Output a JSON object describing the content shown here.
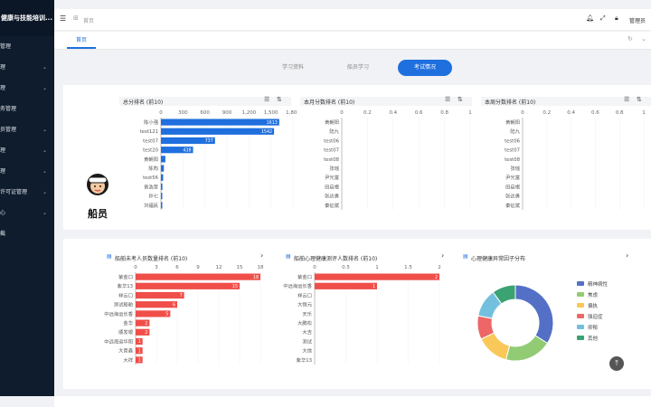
{
  "sidebar": {
    "title": "健康与技能培训...",
    "items": [
      {
        "label": "管理",
        "has_arrow": false
      },
      {
        "label": "理",
        "has_arrow": true
      },
      {
        "label": "理",
        "has_arrow": true
      },
      {
        "label": "务管理",
        "has_arrow": false
      },
      {
        "label": "员管理",
        "has_arrow": true
      },
      {
        "label": "理",
        "has_arrow": true
      },
      {
        "label": "理",
        "has_arrow": true
      },
      {
        "label": "许可证管理",
        "has_arrow": true
      },
      {
        "label": "心",
        "has_arrow": true
      },
      {
        "label": "截",
        "has_arrow": false
      }
    ]
  },
  "topbar": {
    "breadcrumb": "首页",
    "user": "管理员"
  },
  "tabs": {
    "home": "首页"
  },
  "segments": {
    "items": [
      "学习资料",
      "船员学习",
      "考试情况"
    ],
    "active": "考试情况"
  },
  "role": {
    "name": "船员"
  },
  "colors": {
    "accent": "#1f6fde",
    "bar_red": "#f04e49",
    "sidebar": "#0e1c2d"
  },
  "panels_top": [
    {
      "title": "总分排名 (前10)"
    },
    {
      "title": "本月分数排名 (前10)"
    },
    {
      "title": "本周分数排名 (前10)"
    }
  ],
  "panels_bottom": [
    {
      "title": "船舶未考人员数量排名 (前10)"
    },
    {
      "title": "船舶心理健康测评人数排名 (前10)"
    },
    {
      "title": "心理健康异常因子分布"
    }
  ],
  "chart_data": [
    {
      "type": "bar",
      "title": "总分排名 (前10)",
      "orientation": "horizontal",
      "categories": [
        "陈小强",
        "test121",
        "test07",
        "test20",
        "黄朝阳",
        "陈昀",
        "test56",
        "曾浩哲",
        "孙七",
        "刘福民"
      ],
      "values": [
        1613,
        1542,
        737,
        438,
        60,
        40,
        30,
        20,
        10,
        5
      ],
      "data_labels": [
        "1613",
        "1542",
        "737",
        "438",
        "",
        "",
        "",
        "",
        "",
        ""
      ],
      "xlim": [
        0,
        1800
      ],
      "ticks": [
        "0",
        "300",
        "600",
        "900",
        "1,200",
        "1,500",
        "1,800"
      ]
    },
    {
      "type": "bar",
      "title": "本月分数排名 (前10)",
      "orientation": "horizontal",
      "categories": [
        "黄朝阳",
        "陆九",
        "test06",
        "test07",
        "test08",
        "张瑶",
        "尹光富",
        "田启根",
        "张达勇",
        "秦征斌"
      ],
      "values": [
        0,
        0,
        0,
        0,
        0,
        0,
        0,
        0,
        0,
        0
      ],
      "xlim": [
        0,
        1
      ],
      "ticks": [
        "0",
        "0.2",
        "0.4",
        "0.6",
        "0.8",
        "1"
      ]
    },
    {
      "type": "bar",
      "title": "本周分数排名 (前10)",
      "orientation": "horizontal",
      "categories": [
        "黄朝阳",
        "陆九",
        "test06",
        "test07",
        "test08",
        "张瑶",
        "尹光富",
        "田启根",
        "张达勇",
        "秦征斌"
      ],
      "values": [
        0,
        0,
        0,
        0,
        0,
        0,
        0,
        0,
        0,
        0
      ],
      "xlim": [
        0,
        1
      ],
      "ticks": [
        "0",
        "0.2",
        "0.4",
        "0.6",
        "0.8",
        "1"
      ]
    },
    {
      "type": "bar",
      "title": "船舶未考人员数量排名 (前10)",
      "orientation": "horizontal",
      "categories": [
        "紫金口",
        "紫华13",
        "祥云口",
        "测试船舶",
        "中远海运长香",
        "金华",
        "顺发银",
        "中远海运华阳",
        "大商鑫",
        "大祥"
      ],
      "values": [
        18,
        15,
        7,
        6,
        5,
        2,
        2,
        1,
        1,
        1
      ],
      "data_labels": [
        "18",
        "15",
        "7",
        "6",
        "5",
        "2",
        "2",
        "1",
        "1",
        "1"
      ],
      "xlim": [
        0,
        18
      ],
      "ticks": [
        "0",
        "3",
        "6",
        "9",
        "12",
        "15",
        "18"
      ]
    },
    {
      "type": "bar",
      "title": "船舶心理健康测评人数排名 (前10)",
      "orientation": "horizontal",
      "categories": [
        "紫金口",
        "中远海运长香",
        "祥云口",
        "大恒元",
        "天乐",
        "大鹏松",
        "大吉",
        "测试",
        "大信",
        "紫华13"
      ],
      "values": [
        2,
        1,
        0,
        0,
        0,
        0,
        0,
        0,
        0,
        0
      ],
      "data_labels": [
        "2",
        "1",
        "",
        "",
        "",
        "",
        "",
        "",
        "",
        ""
      ],
      "xlim": [
        0,
        2
      ],
      "ticks": [
        "0",
        "0.5",
        "1",
        "1.5",
        "2"
      ]
    },
    {
      "type": "pie",
      "title": "心理健康异常因子分布",
      "donut": true,
      "categories": [
        "精神病性",
        "焦虑",
        "偏执",
        "强迫症",
        "抑郁",
        "其他"
      ],
      "values": [
        34,
        20,
        14,
        10,
        12,
        10
      ],
      "colors": [
        "#5470c6",
        "#91cc75",
        "#fac858",
        "#ee6666",
        "#73c0de",
        "#3ba272"
      ]
    }
  ]
}
